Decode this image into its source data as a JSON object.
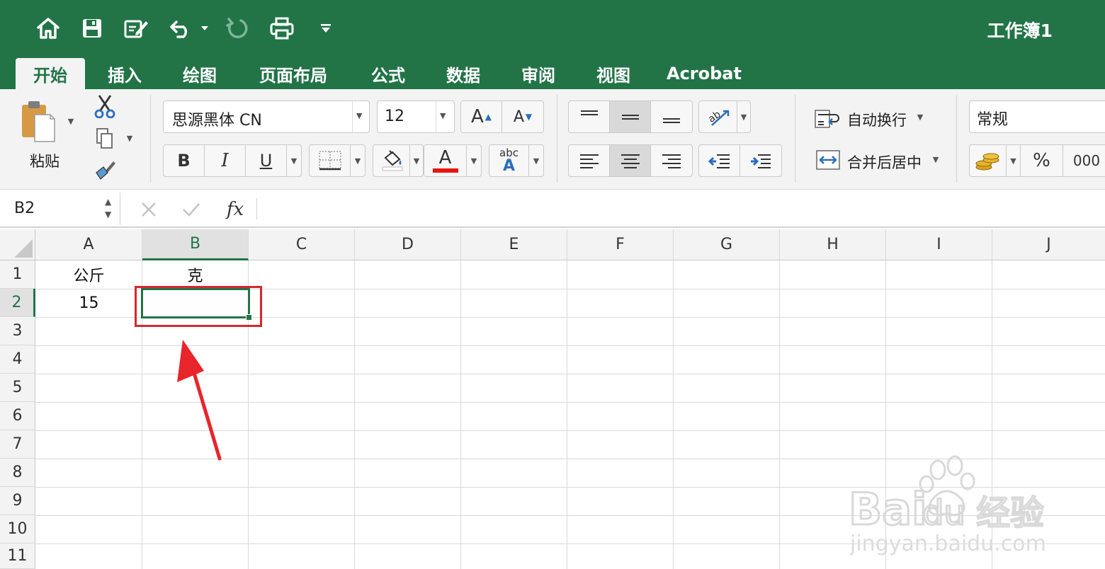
{
  "window": {
    "title": "工作簿1"
  },
  "quick_access": {
    "icons": [
      "home-icon",
      "save-icon",
      "edit-document-icon",
      "undo-icon",
      "redo-icon",
      "print-icon",
      "customize-icon"
    ]
  },
  "tabs": [
    {
      "label": "开始",
      "active": true
    },
    {
      "label": "插入"
    },
    {
      "label": "绘图"
    },
    {
      "label": "页面布局"
    },
    {
      "label": "公式"
    },
    {
      "label": "数据"
    },
    {
      "label": "审阅"
    },
    {
      "label": "视图"
    },
    {
      "label": "Acrobat"
    }
  ],
  "ribbon": {
    "paste_label": "粘贴",
    "font_name": "思源黑体 CN",
    "font_size": "12",
    "increase_font_label": "A",
    "decrease_font_label": "A",
    "bold_label": "B",
    "italic_label": "I",
    "underline_label": "U",
    "font_color_label": "A",
    "phonetic_top": "abc",
    "phonetic_bottom": "A",
    "wrap_text_label": "自动换行",
    "merge_center_label": "合并后居中",
    "number_format": "常规",
    "percent_label": "%",
    "comma_label": "000",
    "font_color": "#e8150e",
    "accent": "#227447"
  },
  "formula_bar": {
    "name_box": "B2",
    "fx_label": "fx",
    "formula": ""
  },
  "sheet": {
    "columns": [
      "A",
      "B",
      "C",
      "D",
      "E",
      "F",
      "G",
      "H",
      "I",
      "J"
    ],
    "rows": [
      "1",
      "2",
      "3",
      "4",
      "5",
      "6",
      "7",
      "8",
      "9",
      "10",
      "11"
    ],
    "selected_cell": "B2",
    "cells": {
      "A1": "公斤",
      "B1": "克",
      "A2": "15"
    }
  },
  "annotation": {
    "highlight_color": "#d6282e",
    "arrow_color": "#e8252b"
  }
}
